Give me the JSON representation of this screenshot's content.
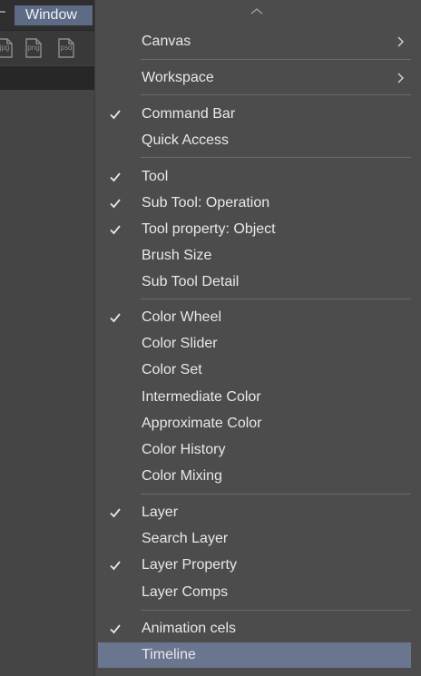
{
  "menubar": {
    "window_label": "Window"
  },
  "toolbar": {
    "icons": [
      {
        "name": "export-jpg-icon",
        "ext": "jpg"
      },
      {
        "name": "export-png-icon",
        "ext": "png"
      },
      {
        "name": "export-psd-icon",
        "ext": "psd"
      }
    ]
  },
  "menu": {
    "canvas": "Canvas",
    "workspace": "Workspace",
    "command_bar": "Command Bar",
    "quick_access": "Quick Access",
    "tool": "Tool",
    "sub_tool_operation": "Sub Tool: Operation",
    "tool_property_object": "Tool property: Object",
    "brush_size": "Brush Size",
    "sub_tool_detail": "Sub Tool Detail",
    "color_wheel": "Color Wheel",
    "color_slider": "Color Slider",
    "color_set": "Color Set",
    "intermediate_color": "Intermediate Color",
    "approximate_color": "Approximate Color",
    "color_history": "Color History",
    "color_mixing": "Color Mixing",
    "layer": "Layer",
    "search_layer": "Search Layer",
    "layer_property": "Layer Property",
    "layer_comps": "Layer Comps",
    "animation_cels": "Animation cels",
    "timeline": "Timeline"
  },
  "colors": {
    "highlight": "#6a7690",
    "menu_background": "#4c4c4c",
    "window_menu_active": "#5d6b85"
  }
}
